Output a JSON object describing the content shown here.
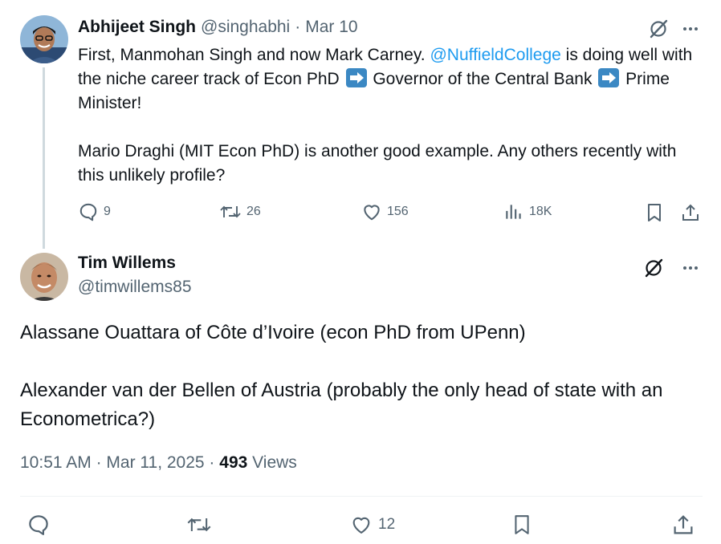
{
  "parent_tweet": {
    "author_name": "Abhijeet Singh",
    "handle": "@singhabhi",
    "separator": "·",
    "date": "Mar 10",
    "body": {
      "line1_pre": "First, Manmohan Singh and now Mark Carney. ",
      "mention": "@NuffieldCollege",
      "line1_post": " is doing well with the niche career track of Econ PhD ",
      "mid": " Governor of the Central Bank ",
      "end": " Prime Minister!",
      "para2": "Mario Draghi (MIT Econ PhD) is another good example. Any others recently with this unlikely profile?"
    },
    "actions": {
      "replies": "9",
      "reposts": "26",
      "likes": "156",
      "views": "18K"
    }
  },
  "reply_tweet": {
    "author_name": "Tim Willems",
    "handle": "@timwillems85",
    "body": {
      "para1": "Alassane Ouattara of Côte d’Ivoire (econ PhD from UPenn)",
      "para2": "Alexander van der Bellen of Austria (probably the only head of state with an Econometrica?)"
    },
    "meta": {
      "time": "10:51 AM",
      "sep1": " · ",
      "date": "Mar 11, 2025",
      "sep2": " · ",
      "views_count": "493",
      "views_label": " Views"
    },
    "actions": {
      "likes": "12"
    }
  },
  "colors": {
    "link": "#1d9bf0",
    "muted": "#536471",
    "text": "#0f1419",
    "thread_line": "#cfd9de"
  },
  "icons": [
    "grok-icon",
    "more-icon",
    "reply-icon",
    "repost-icon",
    "like-icon",
    "views-icon",
    "bookmark-icon",
    "share-icon",
    "arrow-right-emoji"
  ]
}
